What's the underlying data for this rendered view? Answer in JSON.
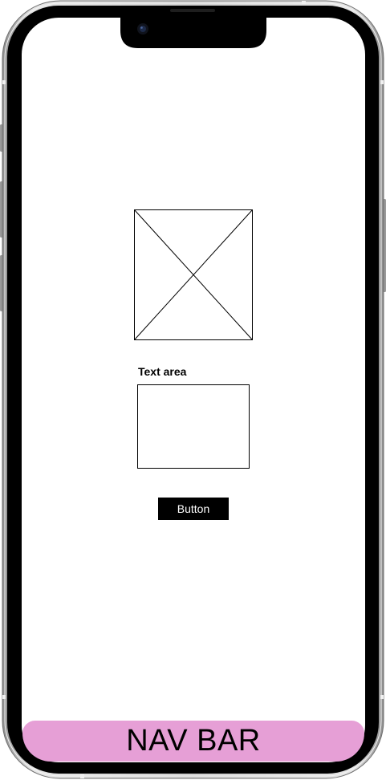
{
  "screen": {
    "text_area_label": "Text area",
    "button_label": "Button",
    "nav_bar_label": "NAV BAR"
  },
  "colors": {
    "nav_bar_background": "#e69fd6",
    "button_background": "#000000",
    "button_text": "#ffffff",
    "screen_background": "#ffffff",
    "phone_bezel": "#000000",
    "phone_frame": "#c9c9c9"
  },
  "icons": {
    "image_placeholder": "image-placeholder-icon",
    "camera": "front-camera-icon"
  }
}
